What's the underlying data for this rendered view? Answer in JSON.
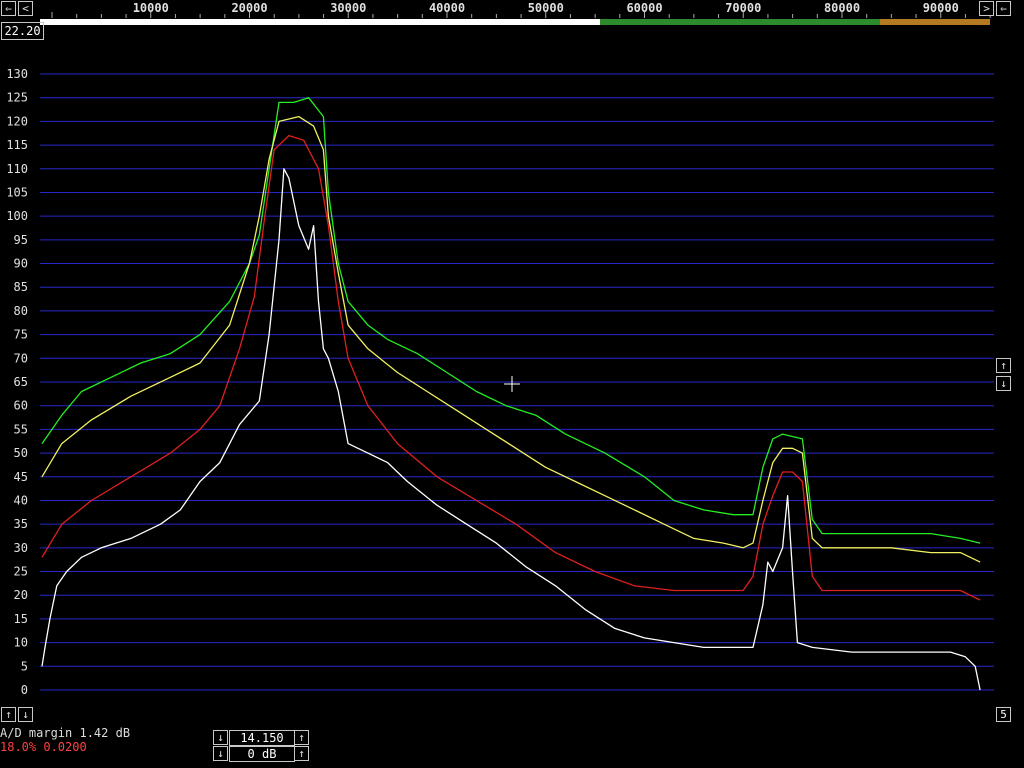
{
  "header": {
    "ticks": [
      "10000",
      "20000",
      "30000",
      "40000",
      "50000",
      "60000",
      "70000",
      "80000",
      "90000"
    ],
    "left_value": "22.20"
  },
  "buttons": {
    "scroll_left": "⇐",
    "step_left": "<",
    "step_right": ">",
    "scroll_right": "⇐",
    "level_up": "↑",
    "level_down": "↓",
    "zoom_up": "↑",
    "zoom_down": "↓",
    "right_number": "5"
  },
  "status": {
    "ad_margin": "A/D margin 1.42 dB",
    "ad_ratio": "18.0% 0.0200"
  },
  "controls": {
    "freq_value": "14.150",
    "gain_value": "0 dB"
  },
  "colors": {
    "grid": "#2828c8",
    "green": "#22ee22",
    "yellow": "#f0f060",
    "red": "#e02020",
    "white": "#ffffff"
  },
  "chart_data": {
    "type": "line",
    "xlim": [
      0,
      96000
    ],
    "ylim": [
      0,
      130
    ],
    "ytick_labels": [
      "0",
      "5",
      "10",
      "15",
      "20",
      "25",
      "30",
      "35",
      "40",
      "45",
      "50",
      "55",
      "60",
      "65",
      "70",
      "75",
      "80",
      "85",
      "90",
      "95",
      "100",
      "105",
      "110",
      "115",
      "120",
      "125",
      "130"
    ],
    "series": [
      {
        "color": "green",
        "points": [
          [
            0,
            52
          ],
          [
            2000,
            58
          ],
          [
            4000,
            63
          ],
          [
            7000,
            66
          ],
          [
            10000,
            69
          ],
          [
            13000,
            71
          ],
          [
            16000,
            75
          ],
          [
            19000,
            82
          ],
          [
            21000,
            90
          ],
          [
            22000,
            96
          ],
          [
            23000,
            110
          ],
          [
            24000,
            124
          ],
          [
            25500,
            124
          ],
          [
            27000,
            125
          ],
          [
            28500,
            121
          ],
          [
            29000,
            105
          ],
          [
            30000,
            90
          ],
          [
            31000,
            82
          ],
          [
            33000,
            77
          ],
          [
            35000,
            74
          ],
          [
            38000,
            71
          ],
          [
            41000,
            67
          ],
          [
            44000,
            63
          ],
          [
            47000,
            60
          ],
          [
            50000,
            58
          ],
          [
            53000,
            54
          ],
          [
            57000,
            50
          ],
          [
            61000,
            45
          ],
          [
            64000,
            40
          ],
          [
            67000,
            38
          ],
          [
            70000,
            37
          ],
          [
            72000,
            37
          ],
          [
            73000,
            47
          ],
          [
            74000,
            53
          ],
          [
            75000,
            54
          ],
          [
            77000,
            53
          ],
          [
            78000,
            36
          ],
          [
            79000,
            33
          ],
          [
            82000,
            33
          ],
          [
            86000,
            33
          ],
          [
            90000,
            33
          ],
          [
            93000,
            32
          ],
          [
            95000,
            31
          ]
        ]
      },
      {
        "color": "yellow",
        "points": [
          [
            0,
            45
          ],
          [
            2000,
            52
          ],
          [
            5000,
            57
          ],
          [
            9000,
            62
          ],
          [
            13000,
            66
          ],
          [
            16000,
            69
          ],
          [
            19000,
            77
          ],
          [
            21000,
            90
          ],
          [
            22000,
            100
          ],
          [
            23000,
            112
          ],
          [
            24000,
            120
          ],
          [
            26000,
            121
          ],
          [
            27500,
            119
          ],
          [
            28500,
            114
          ],
          [
            29000,
            100
          ],
          [
            30000,
            88
          ],
          [
            31000,
            77
          ],
          [
            33000,
            72
          ],
          [
            36000,
            67
          ],
          [
            39000,
            63
          ],
          [
            42000,
            59
          ],
          [
            45000,
            55
          ],
          [
            48000,
            51
          ],
          [
            51000,
            47
          ],
          [
            54000,
            44
          ],
          [
            57000,
            41
          ],
          [
            60000,
            38
          ],
          [
            63000,
            35
          ],
          [
            66000,
            32
          ],
          [
            69000,
            31
          ],
          [
            71000,
            30
          ],
          [
            72000,
            31
          ],
          [
            73000,
            40
          ],
          [
            74000,
            48
          ],
          [
            75000,
            51
          ],
          [
            76000,
            51
          ],
          [
            77000,
            50
          ],
          [
            78000,
            32
          ],
          [
            79000,
            30
          ],
          [
            82000,
            30
          ],
          [
            86000,
            30
          ],
          [
            90000,
            29
          ],
          [
            93000,
            29
          ],
          [
            95000,
            27
          ]
        ]
      },
      {
        "color": "red",
        "points": [
          [
            0,
            28
          ],
          [
            2000,
            35
          ],
          [
            5000,
            40
          ],
          [
            9000,
            45
          ],
          [
            13000,
            50
          ],
          [
            16000,
            55
          ],
          [
            18000,
            60
          ],
          [
            20000,
            72
          ],
          [
            21500,
            83
          ],
          [
            22500,
            99
          ],
          [
            23500,
            114
          ],
          [
            25000,
            117
          ],
          [
            26500,
            116
          ],
          [
            28000,
            110
          ],
          [
            29000,
            98
          ],
          [
            30000,
            82
          ],
          [
            31000,
            70
          ],
          [
            33000,
            60
          ],
          [
            36000,
            52
          ],
          [
            40000,
            45
          ],
          [
            44000,
            40
          ],
          [
            48000,
            35
          ],
          [
            52000,
            29
          ],
          [
            56000,
            25
          ],
          [
            60000,
            22
          ],
          [
            64000,
            21
          ],
          [
            68000,
            21
          ],
          [
            71000,
            21
          ],
          [
            72000,
            24
          ],
          [
            73000,
            35
          ],
          [
            74000,
            41
          ],
          [
            75000,
            46
          ],
          [
            76000,
            46
          ],
          [
            77000,
            44
          ],
          [
            78000,
            24
          ],
          [
            79000,
            21
          ],
          [
            84000,
            21
          ],
          [
            90000,
            21
          ],
          [
            93000,
            21
          ],
          [
            95000,
            19
          ]
        ]
      },
      {
        "color": "white",
        "points": [
          [
            0,
            5
          ],
          [
            300,
            9
          ],
          [
            800,
            15
          ],
          [
            1500,
            22
          ],
          [
            2500,
            25
          ],
          [
            4000,
            28
          ],
          [
            6000,
            30
          ],
          [
            9000,
            32
          ],
          [
            12000,
            35
          ],
          [
            14000,
            38
          ],
          [
            16000,
            44
          ],
          [
            18000,
            48
          ],
          [
            20000,
            56
          ],
          [
            22000,
            61
          ],
          [
            23000,
            75
          ],
          [
            24000,
            95
          ],
          [
            24500,
            110
          ],
          [
            25000,
            108
          ],
          [
            26000,
            98
          ],
          [
            27000,
            93
          ],
          [
            27500,
            98
          ],
          [
            28000,
            82
          ],
          [
            28500,
            72
          ],
          [
            29000,
            70
          ],
          [
            30000,
            63
          ],
          [
            31000,
            52
          ],
          [
            33000,
            50
          ],
          [
            35000,
            48
          ],
          [
            37000,
            44
          ],
          [
            40000,
            39
          ],
          [
            43000,
            35
          ],
          [
            46000,
            31
          ],
          [
            49000,
            26
          ],
          [
            52000,
            22
          ],
          [
            55000,
            17
          ],
          [
            58000,
            13
          ],
          [
            61000,
            11
          ],
          [
            64000,
            10
          ],
          [
            67000,
            9
          ],
          [
            70000,
            9
          ],
          [
            72000,
            9
          ],
          [
            73000,
            18
          ],
          [
            73500,
            27
          ],
          [
            74000,
            25
          ],
          [
            75000,
            30
          ],
          [
            75500,
            41
          ],
          [
            76000,
            25
          ],
          [
            76500,
            10
          ],
          [
            78000,
            9
          ],
          [
            82000,
            8
          ],
          [
            86000,
            8
          ],
          [
            90000,
            8
          ],
          [
            92000,
            8
          ],
          [
            93500,
            7
          ],
          [
            94500,
            5
          ],
          [
            95000,
            0
          ]
        ]
      }
    ]
  }
}
